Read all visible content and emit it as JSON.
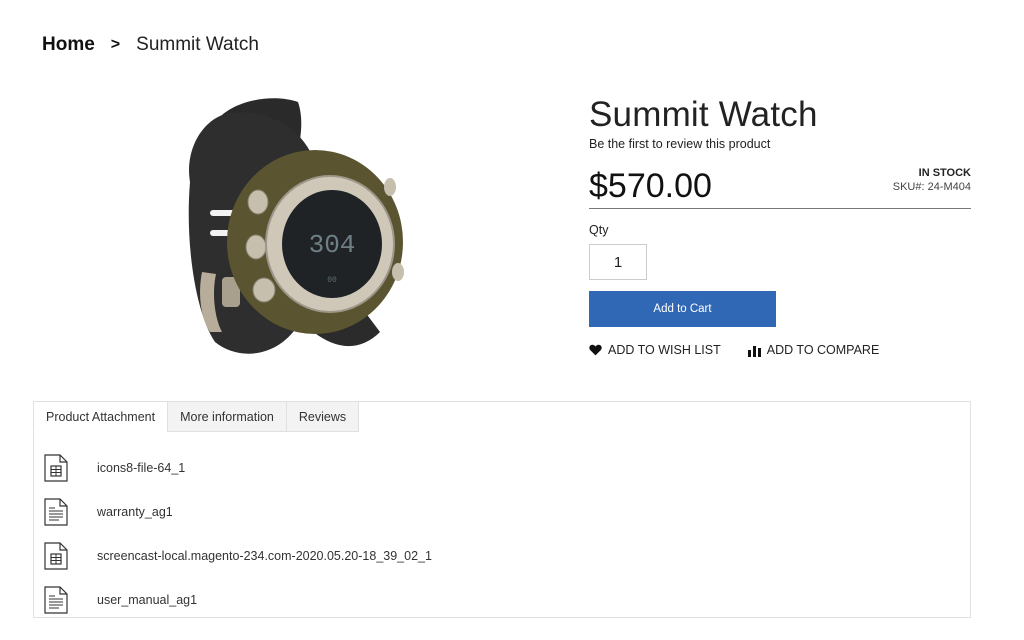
{
  "breadcrumb": {
    "home": "Home",
    "separator": ">",
    "current": "Summit Watch"
  },
  "product": {
    "image_alt": "Summit Watch",
    "title": "Summit Watch",
    "review_link": "Be the first to review this product",
    "price": "$570.00",
    "stock_status": "IN STOCK",
    "sku_label": "SKU#:",
    "sku": "24-M404",
    "sku_text": "SKU#: 24-M404",
    "qty_label": "Qty",
    "qty_value": "1",
    "add_to_cart": "Add to Cart",
    "wishlist": "ADD TO WISH LIST",
    "compare": "ADD TO COMPARE",
    "accent_color": "#3168b5"
  },
  "tabs": [
    {
      "label": "Product Attachment",
      "active": true
    },
    {
      "label": "More information",
      "active": false
    },
    {
      "label": "Reviews",
      "active": false
    }
  ],
  "attachments": [
    {
      "name": "icons8-file-64_1",
      "icon": "video-file-icon"
    },
    {
      "name": "warranty_ag1",
      "icon": "document-file-icon"
    },
    {
      "name": "screencast-local.magento-234.com-2020.05.20-18_39_02_1",
      "icon": "video-file-icon"
    },
    {
      "name": "user_manual_ag1",
      "icon": "document-file-icon"
    }
  ]
}
